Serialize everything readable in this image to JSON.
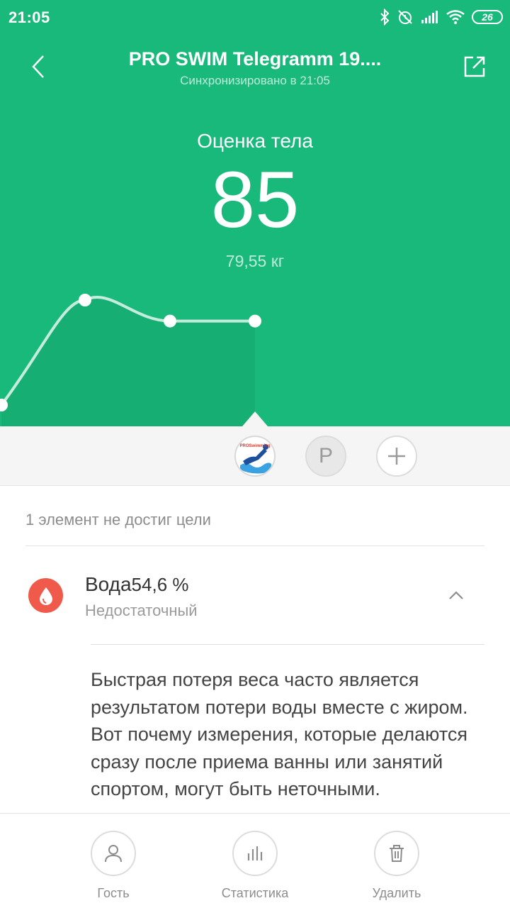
{
  "status_bar": {
    "time": "21:05",
    "battery": "26",
    "icons": [
      "bluetooth-icon",
      "alarm-off-icon",
      "signal-icon",
      "wifi-icon",
      "battery-icon"
    ]
  },
  "header": {
    "title": "PRO SWIM Telegramm 19....",
    "subtitle": "Синхронизировано в 21:05"
  },
  "score": {
    "label": "Оценка тела",
    "value": "85",
    "weight": "79,55 кг"
  },
  "trend_chart": {
    "point_count": 4,
    "relative_levels": [
      0.0,
      1.0,
      0.8,
      0.8
    ]
  },
  "users": {
    "avatar_text": "PROSwimming",
    "guest_letter": "P",
    "add_symbol": "+"
  },
  "results": {
    "summary": "1 элемент не достиг цели",
    "metric": {
      "name": "Вода",
      "value": "54,6",
      "unit": "%",
      "status": "Недостаточный",
      "description": "Быстрая потеря веса часто является результатом потери воды вместе с жиром. Вот почему измерения, которые делаются сразу после приема ванны или занятий спортом, могут быть неточными."
    }
  },
  "actions": {
    "guest": "Гость",
    "stats": "Статистика",
    "delete": "Удалить"
  },
  "colors": {
    "primary": "#19b97b",
    "water": "#ef5a4a"
  }
}
